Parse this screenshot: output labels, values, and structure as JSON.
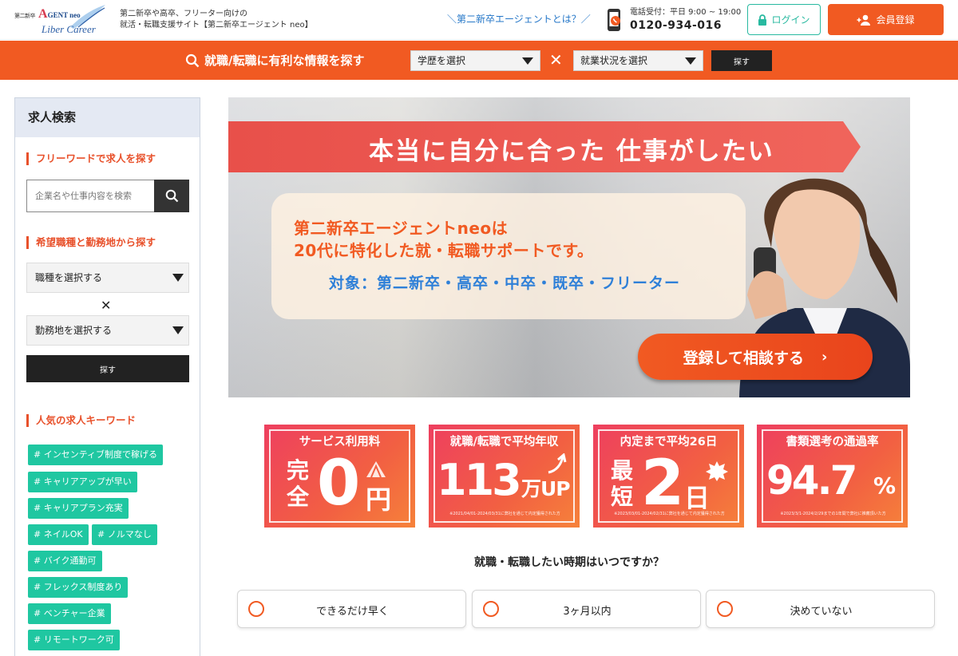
{
  "header": {
    "logo_small": "第二新卒",
    "logo_agent_a": "A",
    "logo_agent_rest": "GENT neo",
    "logo_sub": "Liber Career",
    "tagline_line1": "第二新卒や高卒、フリーター向けの",
    "tagline_line2": "就活・転職支援サイト【第二新卒エージェント neo】",
    "about_link": "＼第二新卒エージェントとは？／",
    "tel_hours": "電話受付：平日 9:00 ~ 19:00",
    "tel_number": "0120-934-016",
    "login_label": "ログイン",
    "register_label": "会員登録"
  },
  "searchbar": {
    "title": "就職/転職に有利な情報を探す",
    "education_select": "学歴を選択",
    "times": "✕",
    "status_select": "就業状況を選択",
    "search_label": "探す"
  },
  "sidebar": {
    "title": "求人検索",
    "freeword_heading": "フリーワードで求人を探す",
    "keyword_placeholder": "企業名や仕事内容を検索",
    "job_heading": "希望職種と勤務地から探す",
    "job_select": "職種を選択する",
    "times": "✕",
    "location_select": "勤務地を選択する",
    "search_label": "探す",
    "keywords_heading": "人気の求人キーワード",
    "tags": [
      "# インセンティブ制度で稼げる",
      "# キャリアアップが早い",
      "# キャリアプラン充実",
      "# ネイルOK",
      "# ノルマなし",
      "# バイク通勤可",
      "# フレックス制度あり",
      "# ベンチャー企業",
      "# リモートワーク可"
    ]
  },
  "hero": {
    "banner": "本当に自分に合った 仕事がしたい",
    "line1": "第二新卒エージェントneoは",
    "line2": "20代に特化した就・転職サポートです。",
    "line3": "対象：第二新卒・高卒・中卒・既卒・フリーター",
    "cta_label": "登録して相談する",
    "cta_arrow": "›"
  },
  "stats": [
    {
      "heading": "サービス利用料",
      "big1": "完",
      "big2": "全",
      "big3": "0",
      "unit": "円",
      "note": ""
    },
    {
      "heading": "就職/転職で平均年収",
      "big1": "113",
      "unit": "万UP",
      "note": "※2021/04/01-2024/03/31に弊社を通じて内定獲得された方"
    },
    {
      "heading": "内定まで平均26日",
      "big1": "最",
      "big2": "短",
      "big3": "2",
      "unit": "日",
      "note": "※2023/03/01-2024/02/31に弊社を通じて内定獲得された方"
    },
    {
      "heading": "書類選考の通過率",
      "big1": "94.7",
      "unit": "%",
      "note": "※2023/3/1-2024/2/29までの1年間で弊社に推薦頂いた方"
    }
  ],
  "question": {
    "text": "就職・転職したい時期はいつですか？",
    "options": [
      "できるだけ早く",
      "3ヶ月以内",
      "決めていない"
    ]
  },
  "colors": {
    "accent": "#f15a22",
    "teal": "#1fc7a1",
    "blue": "#2f80d8"
  }
}
